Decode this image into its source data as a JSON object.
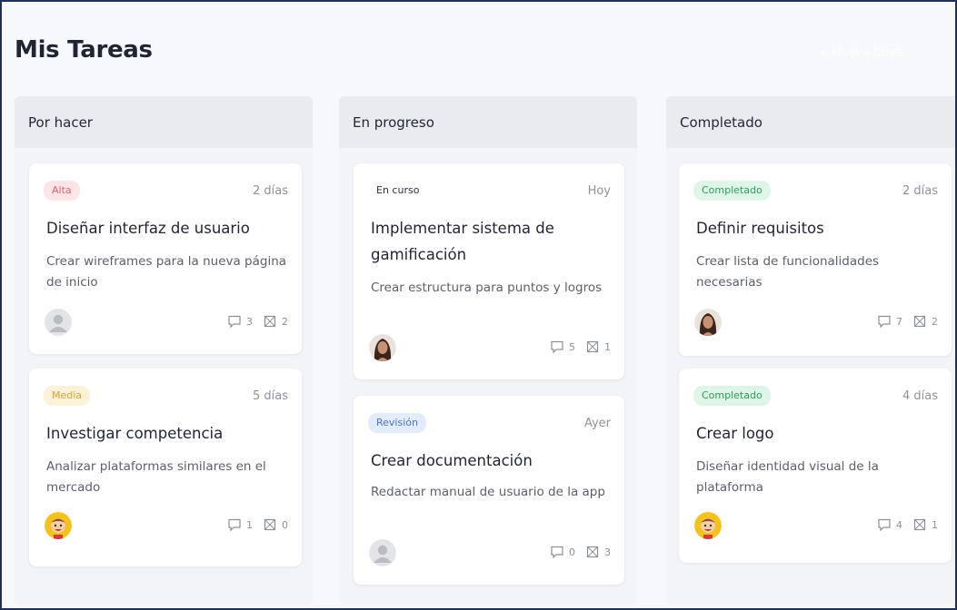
{
  "page": {
    "title": "Mis Tareas",
    "new_task_label": "+ Nueva tarea"
  },
  "columns": [
    {
      "title": "Por hacer",
      "cards": [
        {
          "badge": "Alta",
          "time": "2 días",
          "title": "Diseñar interfaz de usuario",
          "description": "Crear wireframes para la nueva página de inicio",
          "avatar": "default-user-avatar",
          "comments": "3",
          "attachments": "2"
        },
        {
          "badge": "Media",
          "time": "5 días",
          "title": "Investigar competencia",
          "description": "Analizar plataformas similares en el mercado",
          "avatar": "cartoon-boy-avatar",
          "comments": "1",
          "attachments": "0"
        }
      ]
    },
    {
      "title": "En progreso",
      "cards": [
        {
          "badge": "En curso",
          "time": "Hoy",
          "title": "Implementar sistema de gamificación",
          "description": "Crear estructura para puntos y logros",
          "avatar": "woman-photo-avatar",
          "comments": "5",
          "attachments": "1"
        },
        {
          "badge": "Revisión",
          "time": "Ayer",
          "title": "Crear documentación",
          "description": "Redactar manual de usuario de la app",
          "avatar": "default-user-avatar",
          "comments": "0",
          "attachments": "3"
        }
      ]
    },
    {
      "title": "Completado",
      "cards": [
        {
          "badge": "Completado",
          "time": "2 días",
          "title": "Definir requisitos",
          "description": "Crear lista de funcionalidades necesarias",
          "avatar": "woman-photo-avatar",
          "comments": "7",
          "attachments": "2"
        },
        {
          "badge": "Completado",
          "time": "4 días",
          "title": "Crear logo",
          "description": "Diseñar identidad visual de la plataforma",
          "avatar": "cartoon-boy-avatar",
          "comments": "4",
          "attachments": "1"
        }
      ]
    }
  ],
  "icons": {
    "comment": "comment-icon",
    "attachment": "attachment-icon"
  },
  "colors": {
    "alta": "#e06673",
    "media": "#dba13a",
    "revision": "#4d75c9",
    "completado": "#2e9d5c",
    "frame_border": "#1f2f57"
  }
}
